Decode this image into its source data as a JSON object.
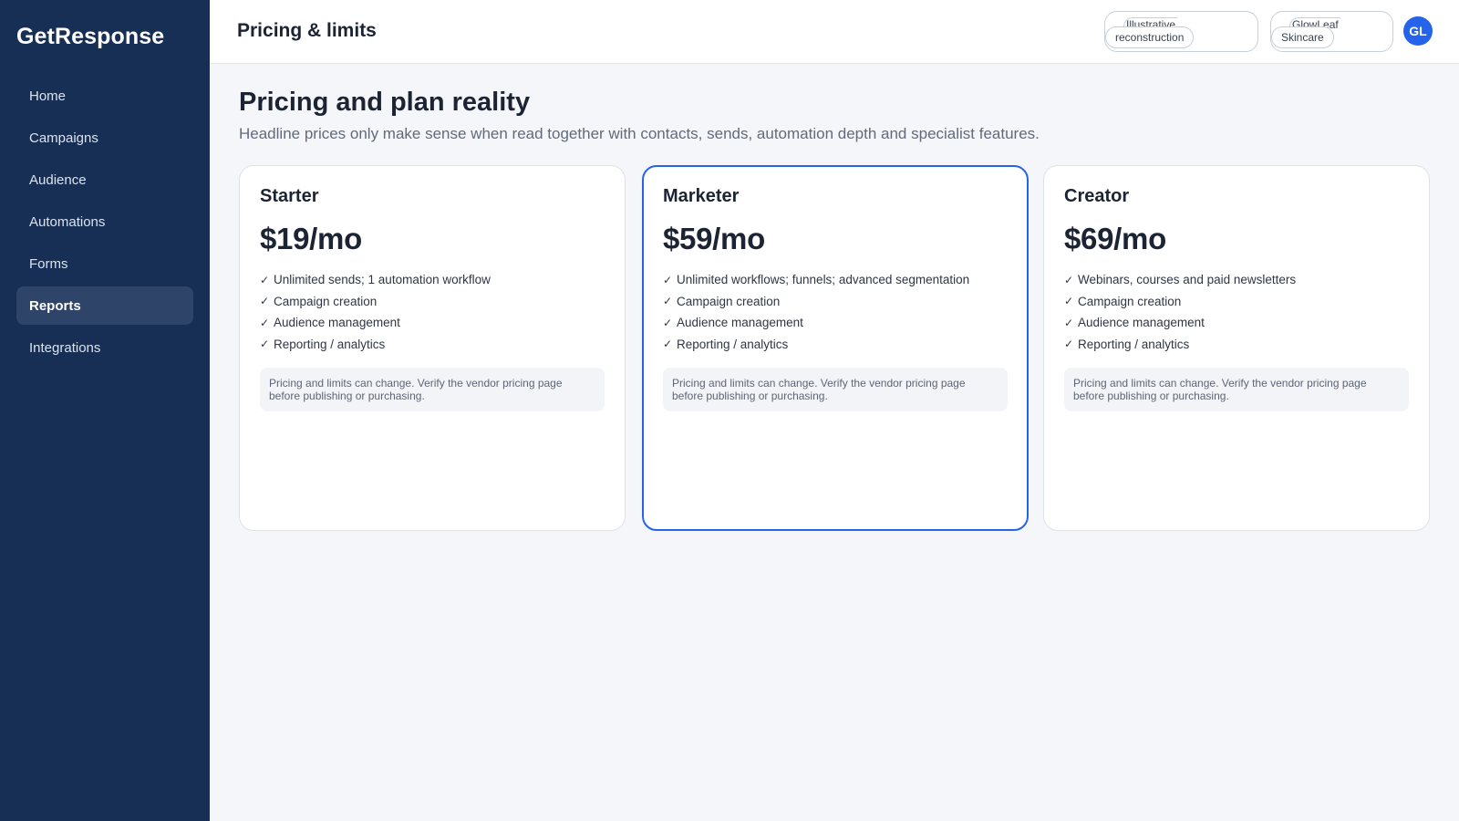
{
  "app": {
    "brand": "GetResponse"
  },
  "sidebar": {
    "items": [
      {
        "label": "Home",
        "active": false
      },
      {
        "label": "Campaigns",
        "active": false
      },
      {
        "label": "Audience",
        "active": false
      },
      {
        "label": "Automations",
        "active": false
      },
      {
        "label": "Forms",
        "active": false
      },
      {
        "label": "Reports",
        "active": true
      },
      {
        "label": "Integrations",
        "active": false
      }
    ]
  },
  "header": {
    "title": "Pricing & limits",
    "pills": [
      {
        "line1": "Illustrative",
        "line2": "reconstruction"
      },
      {
        "line1": "GlowLeaf",
        "line2": "Skincare"
      }
    ],
    "avatar_initials": "GL"
  },
  "main": {
    "title": "Pricing and plan reality",
    "subtitle": "Headline prices only make sense when read together with contacts, sends, automation depth and specialist features.",
    "plans": [
      {
        "name": "Starter",
        "price": "$19/mo",
        "featured": false,
        "features": [
          "Unlimited sends; 1 automation workflow",
          "Campaign creation",
          "Audience management",
          "Reporting / analytics"
        ],
        "disclaimer": "Pricing and limits can change. Verify the vendor pricing page before publishing or purchasing."
      },
      {
        "name": "Marketer",
        "price": "$59/mo",
        "featured": true,
        "features": [
          "Unlimited workflows; funnels; advanced segmentation",
          "Campaign creation",
          "Audience management",
          "Reporting / analytics"
        ],
        "disclaimer": "Pricing and limits can change. Verify the vendor pricing page before publishing or purchasing."
      },
      {
        "name": "Creator",
        "price": "$69/mo",
        "featured": false,
        "features": [
          "Webinars, courses and paid newsletters",
          "Campaign creation",
          "Audience management",
          "Reporting / analytics"
        ],
        "disclaimer": "Pricing and limits can change. Verify the vendor pricing page before publishing or purchasing."
      }
    ]
  },
  "colors": {
    "sidebar_bg": "#172e55",
    "accent": "#2563eb",
    "page_bg": "#f5f6f9"
  },
  "icons": {
    "feature_check": "check-icon"
  }
}
